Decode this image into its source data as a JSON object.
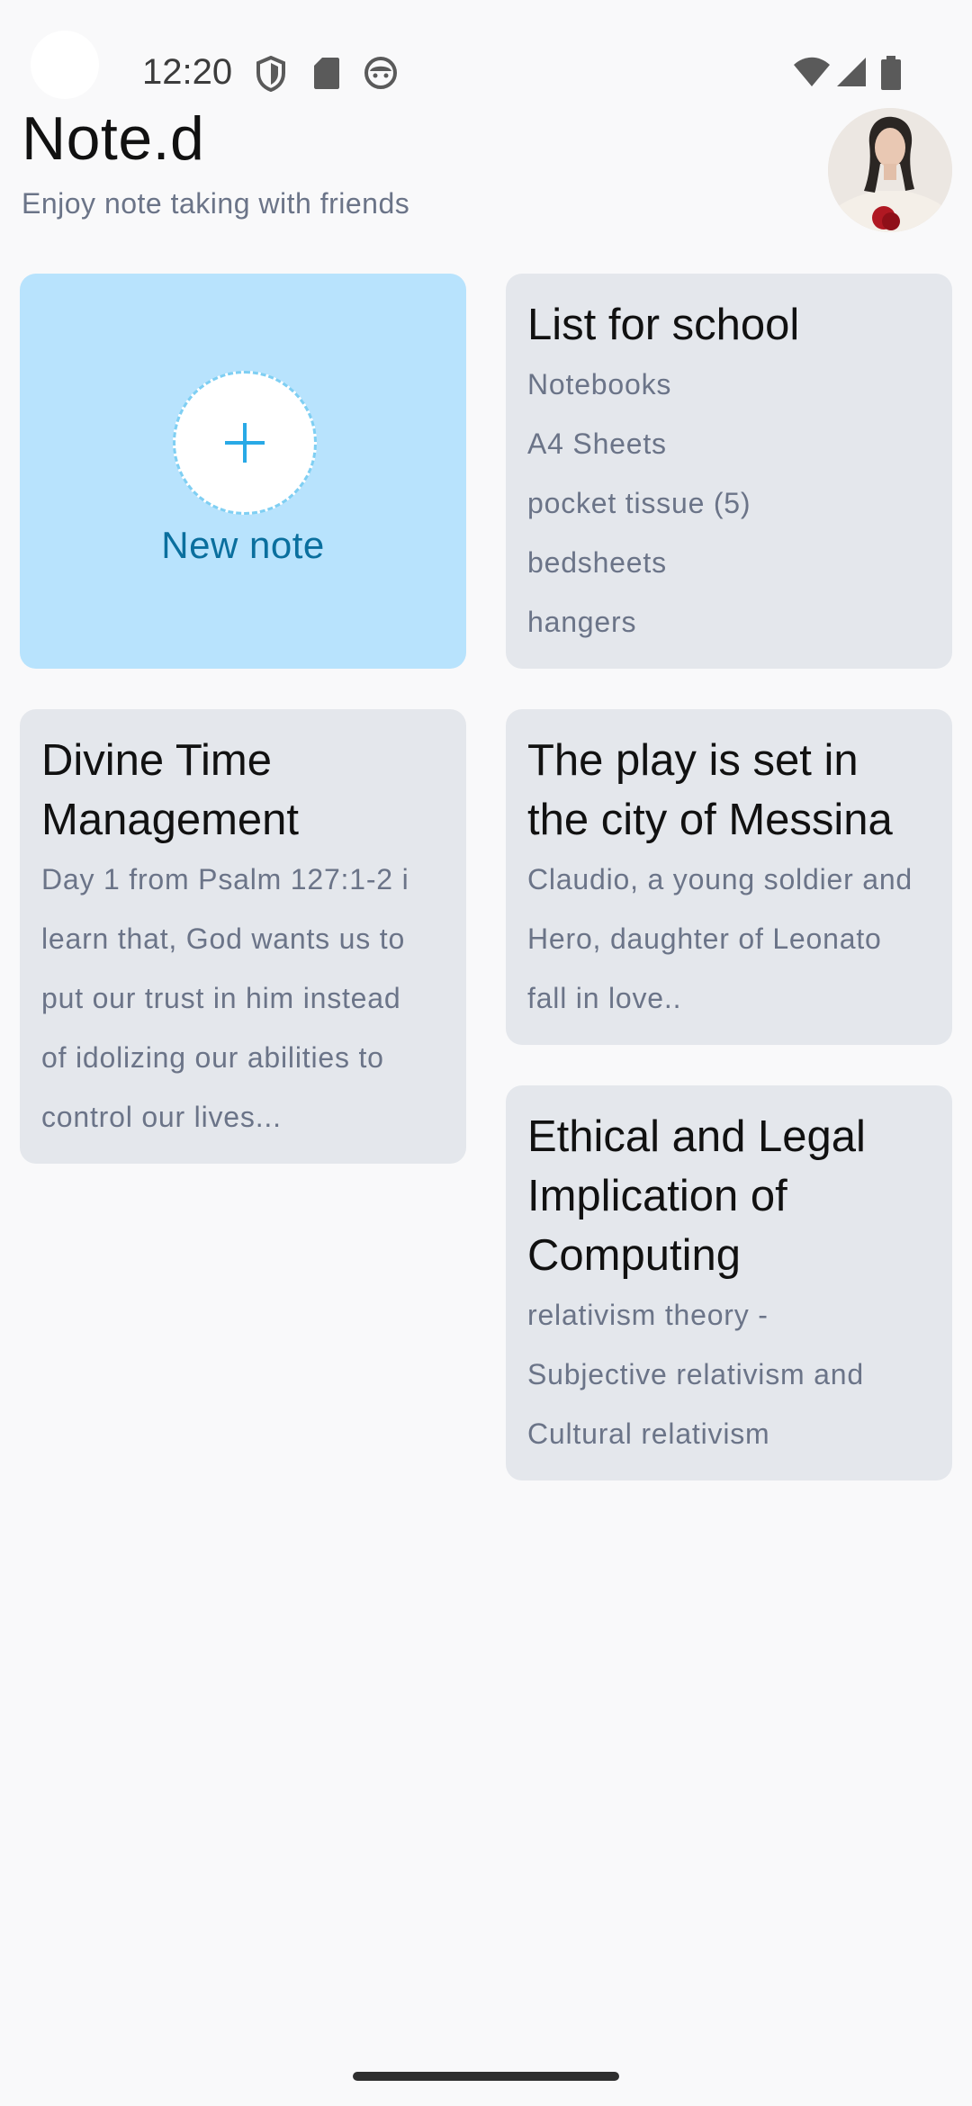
{
  "status_bar": {
    "time": "12:20",
    "left_icons": [
      "shield-icon",
      "sd-card-icon",
      "android-face-icon"
    ],
    "right_icons": [
      "wifi-icon",
      "signal-icon",
      "battery-icon"
    ]
  },
  "header": {
    "title": "Note.d",
    "subtitle": "Enjoy note taking with friends"
  },
  "new_note": {
    "label": "New note",
    "icon": "plus-icon",
    "accent": "#29a9e6"
  },
  "notes": [
    {
      "title": "List for school",
      "items": [
        "Notebooks",
        "A4 Sheets",
        "pocket tissue (5)",
        "bedsheets",
        "hangers"
      ]
    },
    {
      "title": "Divine Time Management",
      "lines": [
        "Day 1 from Psalm 127:1-2 i",
        "learn that, God wants us to",
        "put our trust in him instead",
        "of idolizing our abilities to",
        "control our lives..."
      ]
    },
    {
      "title": "The play is set in the city of Messina",
      "lines": [
        "Claudio, a young soldier and",
        "Hero, daughter of Leonato",
        "fall in love.."
      ]
    },
    {
      "title": "Ethical and Legal Implication of Computing",
      "lines": [
        "relativism theory -",
        "Subjective relativism and",
        "Cultural relativism"
      ]
    }
  ]
}
